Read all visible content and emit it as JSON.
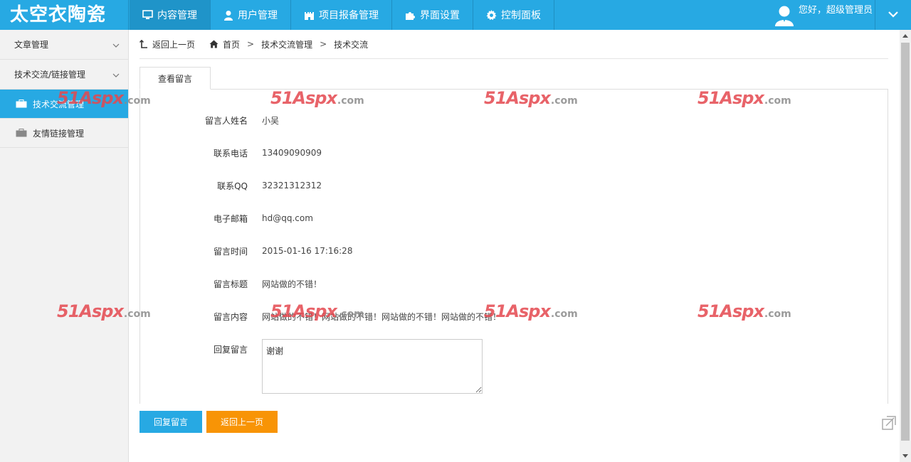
{
  "app": {
    "logo": "太空衣陶瓷"
  },
  "nav": [
    {
      "label": "内容管理",
      "icon": "monitor-icon"
    },
    {
      "label": "用户管理",
      "icon": "user-icon"
    },
    {
      "label": "项目报备管理",
      "icon": "castle-icon"
    },
    {
      "label": "界面设置",
      "icon": "puzzle-icon"
    },
    {
      "label": "控制面板",
      "icon": "gear-icon"
    }
  ],
  "user": {
    "greeting": "您好，超级管理员"
  },
  "sidebar": {
    "groups": [
      {
        "label": "文章管理"
      },
      {
        "label": "技术交流/链接管理"
      }
    ],
    "items": [
      {
        "label": "技术交流管理"
      },
      {
        "label": "友情链接管理"
      }
    ]
  },
  "breadcrumb": {
    "back": "返回上一页",
    "home": "首页",
    "level1": "技术交流管理",
    "level2": "技术交流",
    "separator": ">"
  },
  "tab": {
    "label": "查看留言"
  },
  "form": {
    "fields": [
      {
        "label": "留言人姓名",
        "value": "小吴"
      },
      {
        "label": "联系电话",
        "value": "13409090909"
      },
      {
        "label": "联系QQ",
        "value": "32321312312"
      },
      {
        "label": "电子邮箱",
        "value": "hd@qq.com"
      },
      {
        "label": "留言时间",
        "value": "2015-01-16 17:16:28"
      },
      {
        "label": "留言标题",
        "value": "网站做的不错！"
      },
      {
        "label": "留言内容",
        "value": "网站做的不错！网站做的不错！网站做的不错！网站做的不错！"
      }
    ],
    "reply": {
      "label": "回复留言",
      "value": "谢谢"
    }
  },
  "buttons": {
    "reply": "回复留言",
    "back": "返回上一页"
  },
  "watermark": {
    "main": "51Aspx",
    "suffix": ".com"
  },
  "colors": {
    "primary": "#27a9e3",
    "orange": "#f89406",
    "watermark": "#e5484f"
  }
}
